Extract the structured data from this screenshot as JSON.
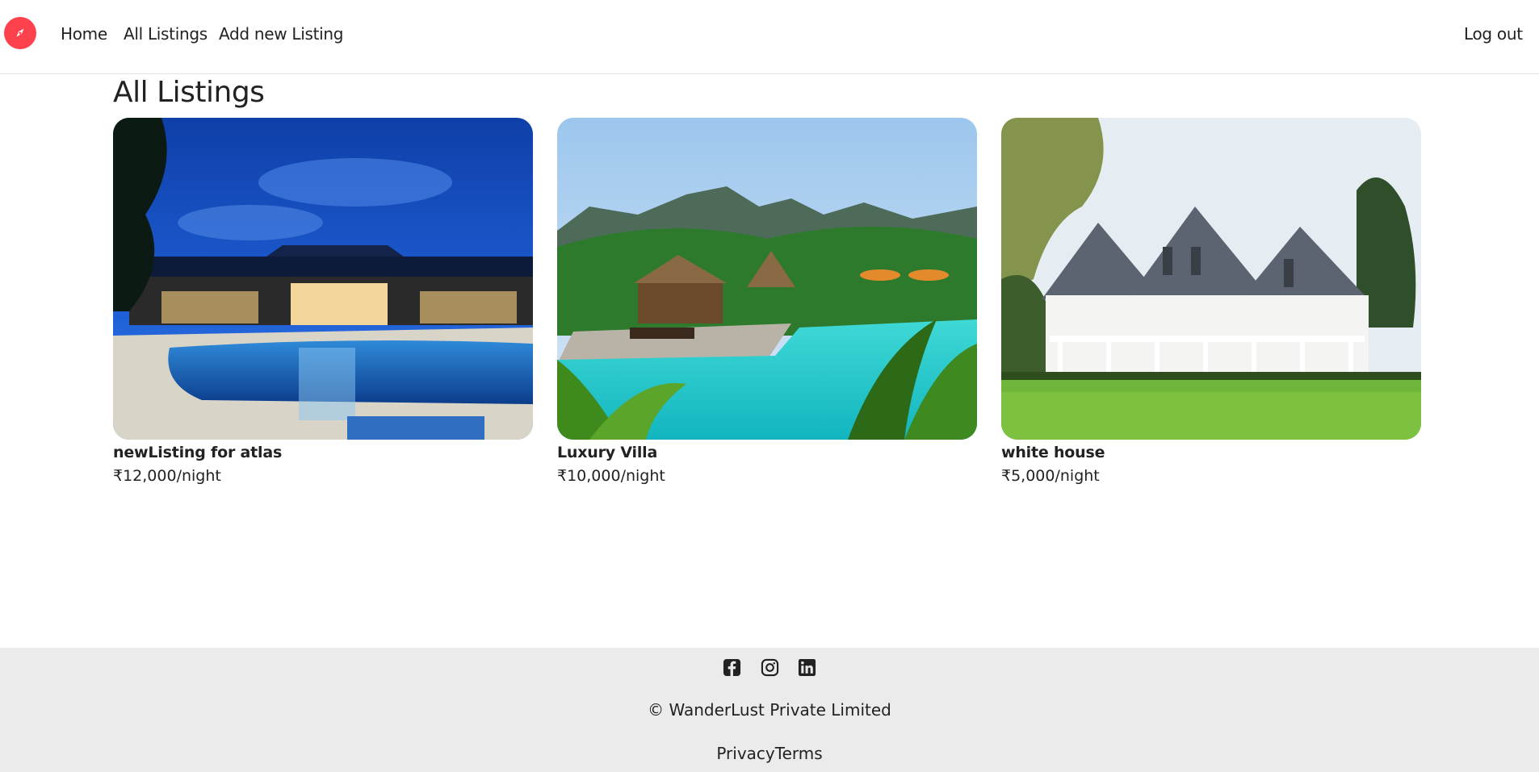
{
  "nav": {
    "logo_icon": "compass-icon",
    "brand_color": "#fe424d",
    "links": [
      "Home",
      "All Listings",
      "Add new Listing"
    ],
    "logout": "Log out"
  },
  "page": {
    "title": "All Listings"
  },
  "listings": [
    {
      "title": "newListing for atlas",
      "price": "₹12,000/night",
      "image": "night resort pool with blue sky"
    },
    {
      "title": "Luxury Villa",
      "price": "₹10,000/night",
      "image": "tropical villa with turquoise pool"
    },
    {
      "title": "white house",
      "price": "₹5,000/night",
      "image": "white house with green lawn"
    }
  ],
  "footer": {
    "social_icons": [
      "facebook-icon",
      "instagram-icon",
      "linkedin-icon"
    ],
    "copyright": "© WanderLust Private Limited",
    "privacy": "Privacy",
    "terms": "Terms"
  }
}
